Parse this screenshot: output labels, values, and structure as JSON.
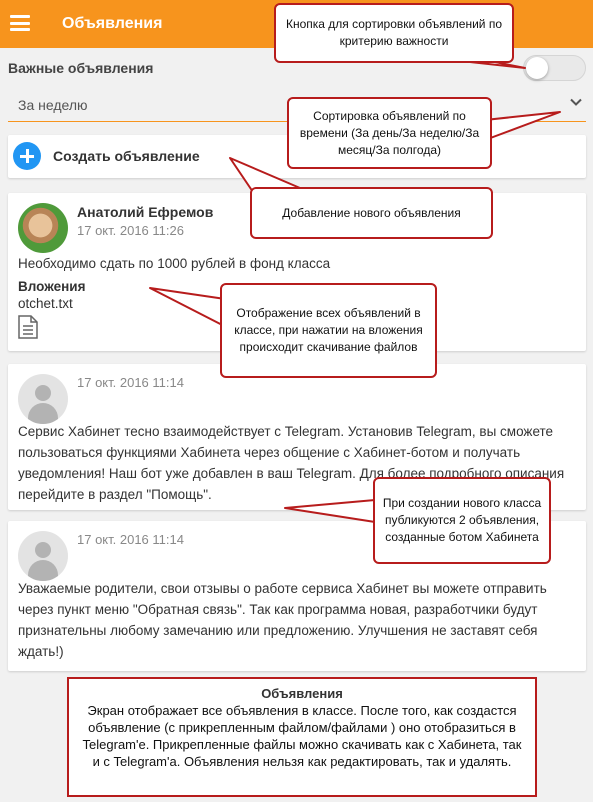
{
  "header": {
    "title": "Объявления"
  },
  "filters": {
    "important_label": "Важные объявления",
    "period_value": "За неделю"
  },
  "create": {
    "label": "Создать объявление"
  },
  "posts": [
    {
      "author": "Анатолий Ефремов",
      "date": "17 окт. 2016 11:26",
      "text": "Необходимо сдать по 1000 рублей в фонд класса",
      "attachments_title": "Вложения",
      "attachment_file": "otchet.txt"
    },
    {
      "author": "",
      "date": "17 окт. 2016 11:14",
      "text": "Сервис Хабинет тесно взаимодействует с Telegram. Установив Telegram, вы сможете пользоваться функциями Хабинета через общение с Хабинет-ботом и получать уведомления! Наш бот уже добавлен в ваш Telegram. Для более подробного описания перейдите в раздел \"Помощь\"."
    },
    {
      "author": "",
      "date": "17 окт. 2016 11:14",
      "text": "Уважаемые родители, свои отзывы о работе сервиса Хабинет вы можете отправить через пункт меню \"Обратная связь\". Так как программа новая, разработчики будут признательны любому замечанию или предложению. Улучшения не заставят себя ждать!)"
    }
  ],
  "callouts": {
    "sort_importance": "Кнопка для сортировки объявлений по критерию важности",
    "sort_time": "Сортировка объявлений по времени (За день/За неделю/За месяц/За полгода)",
    "create": "Добавление нового объявления",
    "show_all": "Отображение всех объявлений в классе, при нажатии на вложения происходит скачивание файлов",
    "publish": "При создании нового класса публикуются 2 объявления, созданные ботом Хабинета"
  },
  "summary": {
    "title": "Объявления",
    "text": "Экран отображает все объявления в классе. После того, как создастся объявление (с прикрепленным файлом/файлами ) оно отобразиться в Telegram'е. Прикрепленные файлы можно скачивать как с Хабинета, так и с Telegram'а. Объявления нельзя как  редактировать, так и удалять."
  },
  "colors": {
    "accent": "#f7941d",
    "primary_button": "#2196f3",
    "callout_border": "#b71c1c"
  },
  "icons": [
    "menu-icon",
    "chevron-down-icon",
    "plus-icon",
    "file-icon",
    "avatar-placeholder-icon"
  ]
}
